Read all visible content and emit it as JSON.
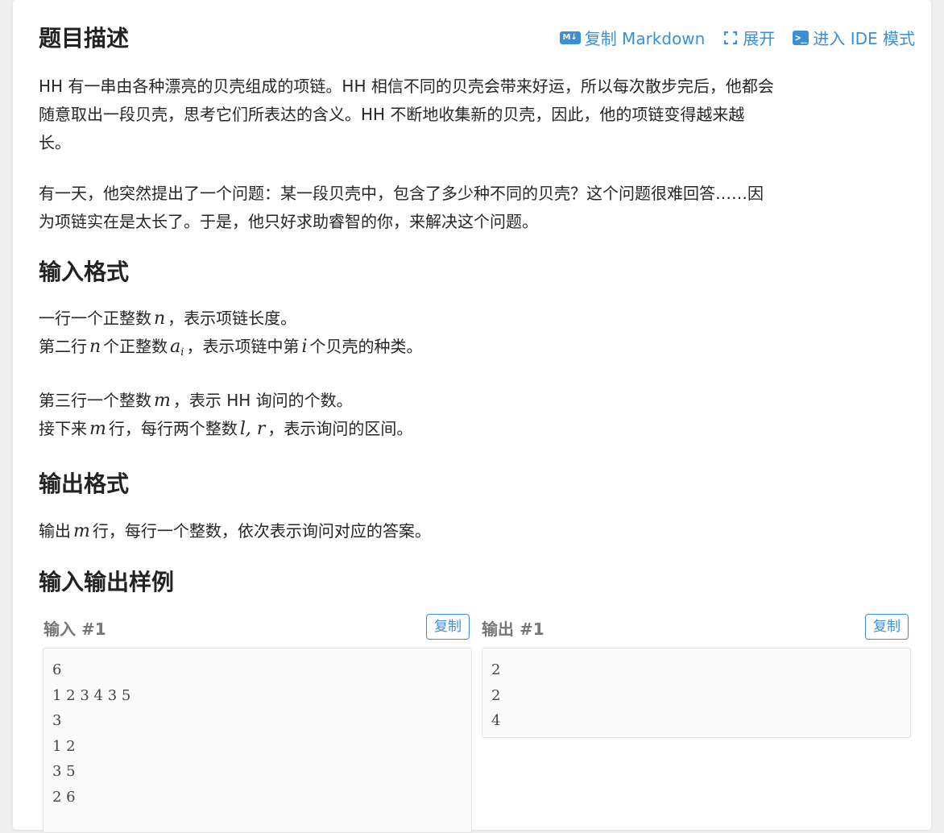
{
  "header": {
    "title": "题目描述",
    "actions": {
      "copy_markdown": "复制 Markdown",
      "expand": "展开",
      "ide_mode": "进入 IDE 模式",
      "md_icon_text": "M↓",
      "ide_icon_text": ">_"
    }
  },
  "description": {
    "p1_line1": "HH 有一串由各种漂亮的贝壳组成的项链。HH 相信不同的贝壳会带来好运，所以每次散步完后，他都会",
    "p1_line2": "随意取出一段贝壳，思考它们所表达的含义。HH 不断地收集新的贝壳，因此，他的项链变得越来越",
    "p1_line3": "长。",
    "p2_line1": "有一天，他突然提出了一个问题：某一段贝壳中，包含了多少种不同的贝壳？这个问题很难回答……因",
    "p2_line2": "为项链实在是太长了。于是，他只好求助睿智的你，来解决这个问题。"
  },
  "input_format": {
    "title": "输入格式",
    "l1_a": "一行一个正整数",
    "l1_var": "n",
    "l1_b": "，表示项链长度。",
    "l2_a": "第二行",
    "l2_var1": "n",
    "l2_b": "个正整数",
    "l2_var2": "a",
    "l2_sub": "i",
    "l2_c": "，表示项链中第",
    "l2_var3": "i",
    "l2_d": "个贝壳的种类。",
    "l3_a": "第三行一个整数",
    "l3_var": "m",
    "l3_b": "，表示 HH 询问的个数。",
    "l4_a": "接下来",
    "l4_var1": "m",
    "l4_b": "行，每行两个整数",
    "l4_var2": "l, r",
    "l4_c": "，表示询问的区间。"
  },
  "output_format": {
    "title": "输出格式",
    "l1_a": "输出",
    "l1_var": "m",
    "l1_b": "行，每行一个整数，依次表示询问对应的答案。"
  },
  "samples": {
    "title": "输入输出样例",
    "copy_label": "复制",
    "input_label": "输入 #1",
    "output_label": "输出 #1",
    "input_text": "6\n1 2 3 4 3 5\n3\n1 2\n3 5\n2 6",
    "output_text": "2\n2\n4"
  }
}
